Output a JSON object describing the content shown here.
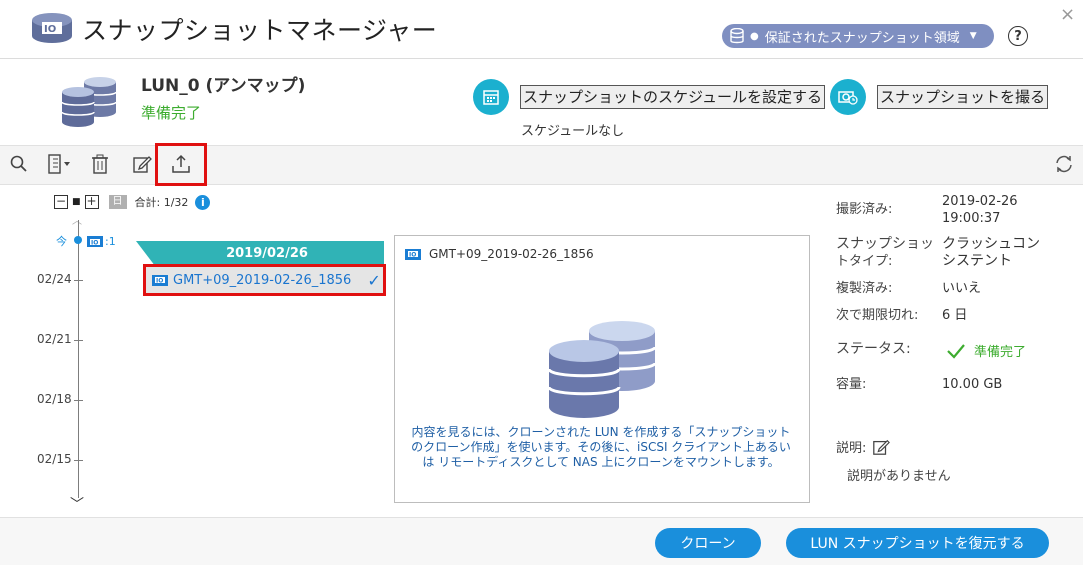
{
  "window": {
    "title": "スナップショットマネージャー",
    "pool_badge": "保証されたスナップショット領域",
    "help": "?",
    "close": "×"
  },
  "lun": {
    "name": "LUN_0 (アンマップ)",
    "status": "準備完了"
  },
  "actions": {
    "schedule_label": "スナップショットのスケジュールを設定する",
    "schedule_note": "スケジュールなし",
    "take_snapshot_label": "スナップショットを撮る"
  },
  "toolbar": {
    "icons": [
      "search-icon",
      "view-options-icon",
      "delete-icon",
      "edit-icon",
      "export-icon",
      "refresh-icon"
    ]
  },
  "timeline": {
    "minus": "−",
    "plus": "+",
    "day_chip": "日",
    "total": "合計: 1/32",
    "info": "i",
    "now": "今",
    "now_count": ":1",
    "dates": [
      "02/24",
      "02/21",
      "02/18",
      "02/15"
    ],
    "group_date": "2019/02/26",
    "snapshot_name": "GMT+09_2019-02-26_1856",
    "snapshot_check": "✓"
  },
  "preview": {
    "title": "GMT+09_2019-02-26_1856",
    "message": "内容を見るには、クローンされた LUN を作成する「スナップショットのクローン作成」を使います。その後に、iSCSI クライアント上あるいは リモートディスクとして NAS 上にクローンをマウントします。"
  },
  "details": {
    "taken_label": "撮影済み:",
    "taken_date": "2019-02-26",
    "taken_time": "19:00:37",
    "type_label_1": "スナップショッ",
    "type_label_2": "トタイプ:",
    "type_value_1": "クラッシュコン",
    "type_value_2": "システント",
    "replicated_label": "複製済み:",
    "replicated_value": "いいえ",
    "expire_label": "次で期限切れ:",
    "expire_value": "6 日",
    "status_label": "ステータス:",
    "status_value": "準備完了",
    "capacity_label": "容量:",
    "capacity_value": "10.00 GB",
    "description_label": "説明:",
    "description_value": "説明がありません"
  },
  "footer": {
    "clone_label": "クローン",
    "restore_label": "LUN スナップショットを復元する"
  },
  "colors": {
    "accent": "#1a8fdc",
    "teal": "#1bb0cf",
    "ready_green": "#3dac2f",
    "highlight_red": "#e01010",
    "pool_badge": "#7f8fc1"
  }
}
